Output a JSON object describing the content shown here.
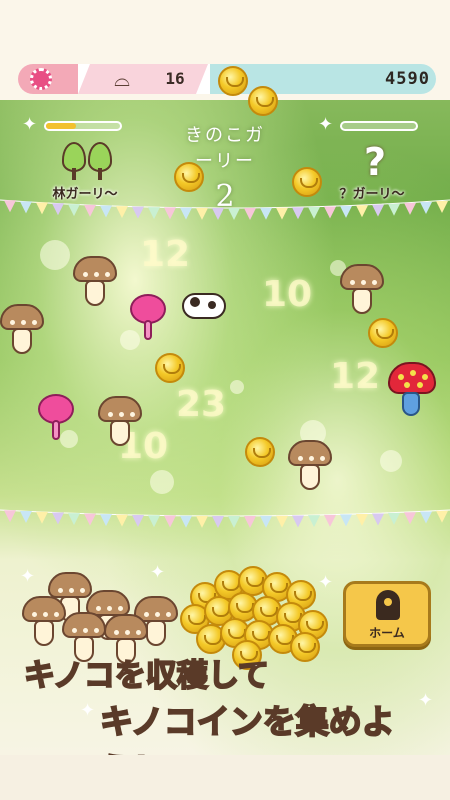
{
  "topbar": {
    "settings_icon": "gear-icon",
    "wardrobe_icon": "hanger-icon",
    "clothes_count": "16",
    "coin_total": "4590"
  },
  "left_gallery": {
    "label": "林ガーリ～",
    "progress": 0.4,
    "icon": "tree-icon"
  },
  "right_gallery": {
    "label": "？ガーリ～",
    "progress": 0.0,
    "icon": "question-icon"
  },
  "logo": {
    "line1": "きのこガーリー",
    "line2": "2"
  },
  "field_numbers": [
    "12",
    "10",
    "12",
    "23",
    "10"
  ],
  "home_button": {
    "label": "ホーム",
    "icon": "house-icon"
  },
  "caption": {
    "line1": "キノコを収穫して",
    "line2_highlight": "キノコイン",
    "line2_rest": "を集めよう！"
  },
  "colors": {
    "settings_pink": "#e84f84",
    "coin_gold": "#f4c928",
    "mushroom_brown": "#b88a5e",
    "pink_mushroom": "#ef4d9c",
    "red_mushroom": "#e2273a",
    "caption_yellow": "#ffe24d"
  }
}
